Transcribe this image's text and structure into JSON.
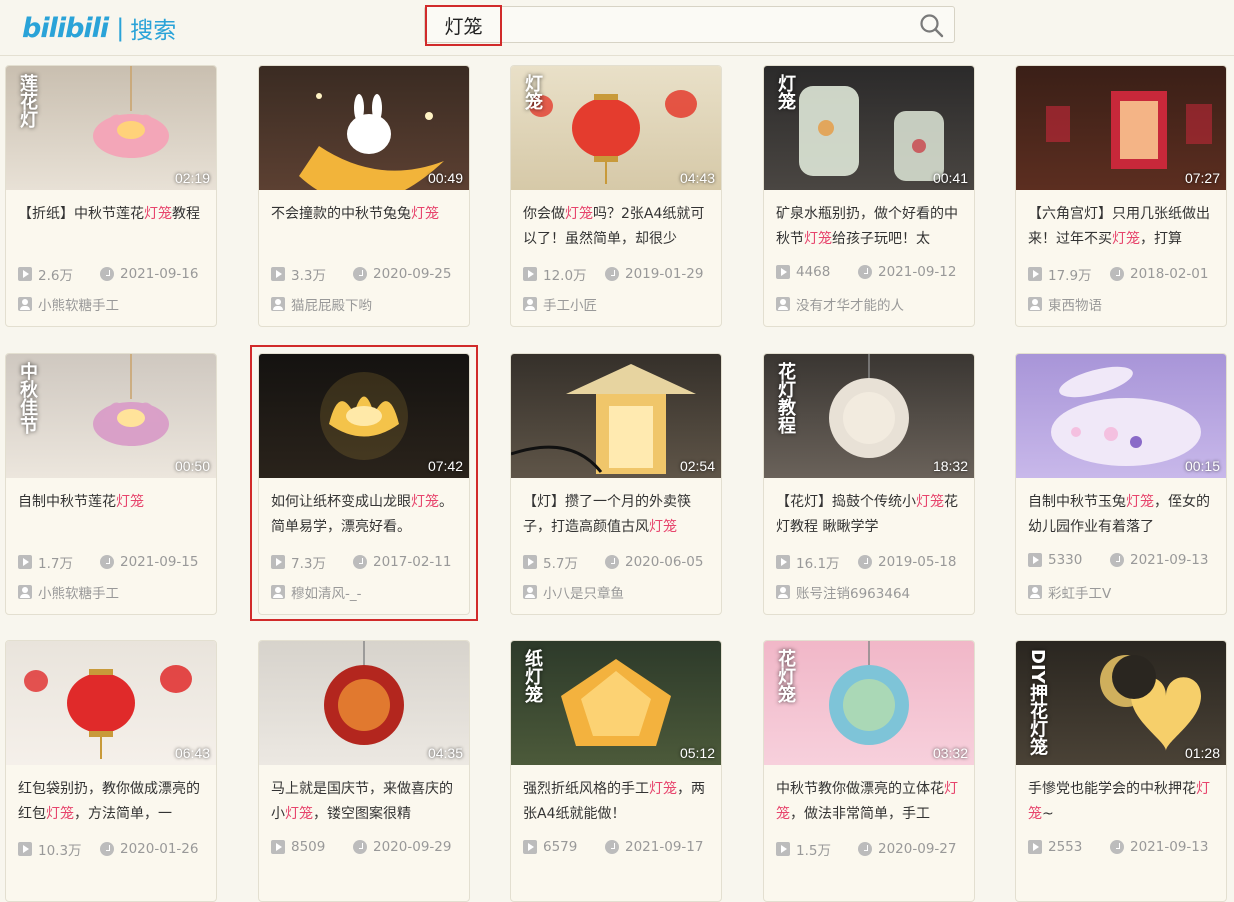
{
  "header": {
    "logo_text": "bilibili",
    "logo_separator": "|",
    "logo_label": "搜索",
    "search_query": "灯笼"
  },
  "videos": [
    {
      "title_pre": "【折纸】中秋节莲花",
      "title_hl": "灯笼",
      "title_post": "教程",
      "duration": "02:19",
      "views": "2.6万",
      "date": "2021-09-16",
      "uploader": "小熊软糖手工",
      "thumb_text": "莲花灯"
    },
    {
      "title_pre": "不会撞款的中秋节兔兔",
      "title_hl": "灯笼",
      "title_post": "",
      "duration": "00:49",
      "views": "3.3万",
      "date": "2020-09-25",
      "uploader": "猫屁屁殿下哟",
      "thumb_text": ""
    },
    {
      "title_pre": "你会做",
      "title_hl": "灯笼",
      "title_post": "吗？2张A4纸就可以了！虽然简单，却很少",
      "duration": "04:43",
      "views": "12.0万",
      "date": "2019-01-29",
      "uploader": "手工小匠",
      "thumb_text": "灯笼"
    },
    {
      "title_pre": "矿泉水瓶别扔，做个好看的中秋节",
      "title_hl": "灯笼",
      "title_post": "给孩子玩吧！太",
      "duration": "00:41",
      "views": "4468",
      "date": "2021-09-12",
      "uploader": "没有才华才能的人",
      "thumb_text": "灯笼"
    },
    {
      "title_pre": "【六角宫灯】只用几张纸做出来！过年不买",
      "title_hl": "灯笼",
      "title_post": "，打算",
      "duration": "07:27",
      "views": "17.9万",
      "date": "2018-02-01",
      "uploader": "東西物语",
      "thumb_text": ""
    },
    {
      "title_pre": "自制中秋节莲花",
      "title_hl": "灯笼",
      "title_post": "",
      "duration": "00:50",
      "views": "1.7万",
      "date": "2021-09-15",
      "uploader": "小熊软糖手工",
      "thumb_text": "中秋佳节"
    },
    {
      "title_pre": "如何让纸杯变成山龙眼",
      "title_hl": "灯笼",
      "title_post": "。简单易学，漂亮好看。",
      "duration": "07:42",
      "views": "7.3万",
      "date": "2017-02-11",
      "uploader": "穆如清风-_-",
      "thumb_text": ""
    },
    {
      "title_pre": "【灯】攒了一个月的外卖筷子，打造高颜值古风",
      "title_hl": "灯笼",
      "title_post": "",
      "duration": "02:54",
      "views": "5.7万",
      "date": "2020-06-05",
      "uploader": "小八是只章鱼",
      "thumb_text": ""
    },
    {
      "title_pre": "【花灯】捣鼓个传统小",
      "title_hl": "灯笼",
      "title_post": "花灯教程 瞅瞅学学",
      "duration": "18:32",
      "views": "16.1万",
      "date": "2019-05-18",
      "uploader": "账号注销6963464",
      "thumb_text": "花灯教程"
    },
    {
      "title_pre": "自制中秋节玉兔",
      "title_hl": "灯笼",
      "title_post": "，侄女的幼儿园作业有着落了",
      "duration": "00:15",
      "views": "5330",
      "date": "2021-09-13",
      "uploader": "彩虹手工V",
      "thumb_text": ""
    },
    {
      "title_pre": "红包袋别扔，教你做成漂亮的红包",
      "title_hl": "灯笼",
      "title_post": "，方法简单，一",
      "duration": "06:43",
      "views": "10.3万",
      "date": "2020-01-26",
      "uploader": "",
      "thumb_text": ""
    },
    {
      "title_pre": "马上就是国庆节，来做喜庆的小",
      "title_hl": "灯笼",
      "title_post": "，镂空图案很精",
      "duration": "04:35",
      "views": "8509",
      "date": "2020-09-29",
      "uploader": "",
      "thumb_text": ""
    },
    {
      "title_pre": "强烈折纸风格的手工",
      "title_hl": "灯笼",
      "title_post": "，两张A4纸就能做！",
      "duration": "05:12",
      "views": "6579",
      "date": "2021-09-17",
      "uploader": "",
      "thumb_text": "纸灯笼"
    },
    {
      "title_pre": "中秋节教你做漂亮的立体花",
      "title_hl": "灯笼",
      "title_post": "，做法非常简单，手工",
      "duration": "03:32",
      "views": "1.5万",
      "date": "2020-09-27",
      "uploader": "",
      "thumb_text": "花灯笼"
    },
    {
      "title_pre": "手慘党也能学会的中秋押花",
      "title_hl": "灯笼",
      "title_post": "~",
      "duration": "01:28",
      "views": "2553",
      "date": "2021-09-13",
      "uploader": "",
      "thumb_text": "DIY押花灯笼"
    }
  ],
  "colors": {
    "accent": "#2aa3d8",
    "highlight": "#e7456d",
    "annotation": "#d12a2a"
  }
}
